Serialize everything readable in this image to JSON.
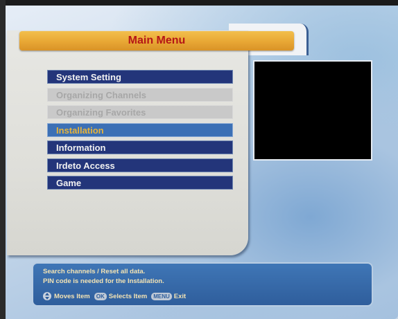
{
  "title": "Main Menu",
  "menu": {
    "items": [
      {
        "label": "System Setting",
        "state": "normal"
      },
      {
        "label": "Organizing Channels",
        "state": "disabled"
      },
      {
        "label": "Organizing Favorites",
        "state": "disabled"
      },
      {
        "label": "Installation",
        "state": "selected"
      },
      {
        "label": "Information",
        "state": "normal"
      },
      {
        "label": "Irdeto Access",
        "state": "normal"
      },
      {
        "label": "Game",
        "state": "normal"
      }
    ]
  },
  "help": {
    "line1": "Search channels / Reset all data.",
    "line2": "PIN code is needed for the Installation.",
    "moves": "Moves Item",
    "ok_key": "OK",
    "selects": "Selects Item",
    "menu_key": "MENU",
    "exit": "Exit"
  },
  "colors": {
    "title_bg": "#e8a734",
    "title_text": "#b51616",
    "item_normal_bg": "#23357a",
    "item_selected_bg": "#3c70b5",
    "item_selected_text": "#e8b43a",
    "item_disabled_bg": "#c9c9c9"
  }
}
